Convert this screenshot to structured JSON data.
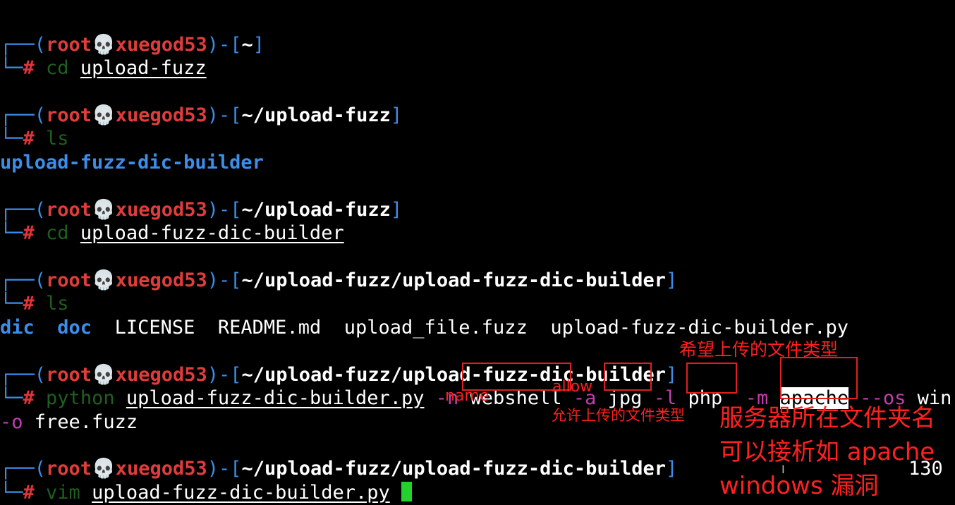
{
  "prompt": {
    "open": "┌──(",
    "user": "root",
    "skull": "💀",
    "host": "xuegod53",
    "mid": ")-[",
    "close": "]",
    "hash": "└─#"
  },
  "blocks": [
    {
      "path": "~",
      "cmd": "cd",
      "arg": "upload-fuzz"
    },
    {
      "path": "~/upload-fuzz",
      "cmd": "ls",
      "output": "upload-fuzz-dic-builder"
    },
    {
      "path": "~/upload-fuzz",
      "cmd": "cd",
      "arg": "upload-fuzz-dic-builder"
    },
    {
      "path": "~/upload-fuzz/upload-fuzz-dic-builder",
      "cmd": "ls",
      "ls_dirs": [
        "dic",
        "doc"
      ],
      "ls_files": [
        "LICENSE",
        "README.md",
        "upload_file.fuzz",
        "upload-fuzz-dic-builder.py"
      ]
    },
    {
      "path": "~/upload-fuzz/upload-fuzz-dic-builder",
      "cmd": "python",
      "arg": "upload-fuzz-dic-builder.py",
      "opts": {
        "n_flag": "-n",
        "n_val": "webshell",
        "a_flag": "-a",
        "a_val": "jpg",
        "l_flag": "-l",
        "l_val": "php",
        "m_flag": "-m",
        "m_val": "apache",
        "os_flag": "--os",
        "os_val": "win",
        "o_flag": "-o",
        "o_val": "free.fuzz"
      }
    },
    {
      "path": "~/upload-fuzz/upload-fuzz-dic-builder",
      "cmd": "vim",
      "arg": "upload-fuzz-dic-builder.py",
      "right_status": "130"
    }
  ],
  "annotations": {
    "hope_type": "希望上传的文件类型",
    "allow": "allow",
    "name": "name",
    "allowed_type": "允许上传的文件类型",
    "server_folder": "服务器所在文件夹名",
    "parse_line": "可以接析如 apache",
    "windows_vuln": "windows 漏洞",
    "cursor_glyph": "I"
  }
}
